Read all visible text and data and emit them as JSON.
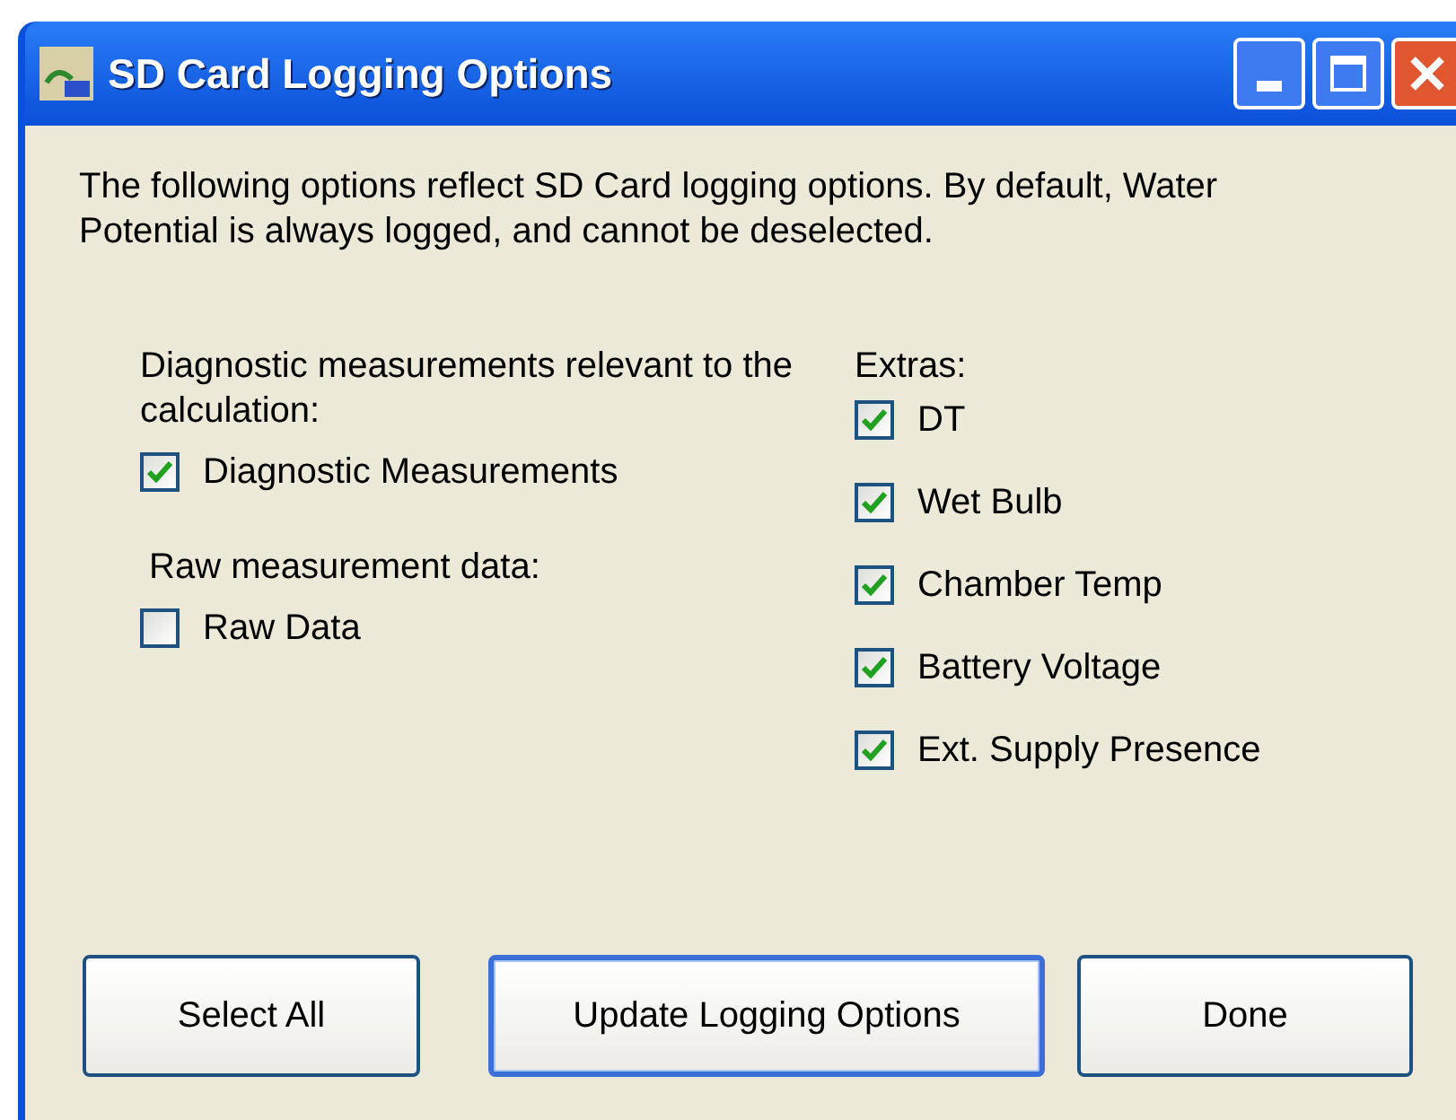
{
  "window": {
    "title": "SD Card Logging Options",
    "controls": [
      {
        "kind": "minimize"
      },
      {
        "kind": "maximize"
      },
      {
        "kind": "close"
      }
    ]
  },
  "intro": "The following options reflect SD Card logging options. By default, Water Potential is always logged, and cannot be deselected.",
  "left_groups": [
    {
      "label": "Diagnostic measurements relevant to the calculation:",
      "options": [
        {
          "label": "Diagnostic Measurements",
          "checked": true
        }
      ]
    },
    {
      "label": "Raw measurement data:",
      "options": [
        {
          "label": "Raw Data",
          "checked": false
        }
      ]
    }
  ],
  "extras": {
    "label": "Extras:",
    "options": [
      {
        "label": "DT",
        "checked": true
      },
      {
        "label": "Wet Bulb",
        "checked": true
      },
      {
        "label": "Chamber Temp",
        "checked": true
      },
      {
        "label": "Battery Voltage",
        "checked": true
      },
      {
        "label": "Ext. Supply Presence",
        "checked": true
      }
    ]
  },
  "buttons": [
    {
      "label": "Select All",
      "default": false
    },
    {
      "label": "Update Logging Options",
      "default": true
    },
    {
      "label": "Done",
      "default": false
    }
  ]
}
